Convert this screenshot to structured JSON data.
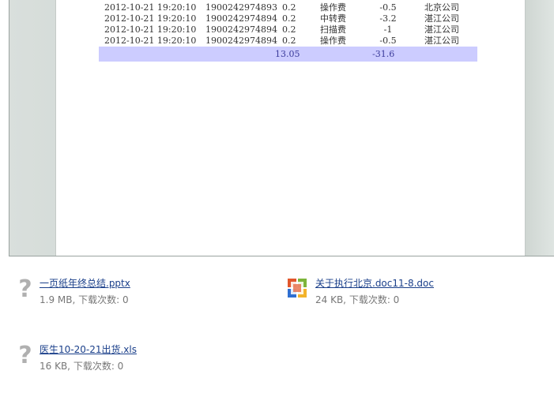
{
  "preview": {
    "rows": [
      {
        "time": "2012-10-21 19:20:10",
        "code": "1900242974893",
        "weight": "0.2",
        "type": "操作费",
        "amount": "-0.5",
        "company": "北京公司"
      },
      {
        "time": "2012-10-21 19:20:10",
        "code": "1900242974894",
        "weight": "0.2",
        "type": "中转费",
        "amount": "-3.2",
        "company": "湛江公司"
      },
      {
        "time": "2012-10-21 19:20:10",
        "code": "1900242974894",
        "weight": "0.2",
        "type": "扫描费",
        "amount": "-1",
        "company": "湛江公司"
      },
      {
        "time": "2012-10-21 19:20:10",
        "code": "1900242974894",
        "weight": "0.2",
        "type": "操作费",
        "amount": "-0.5",
        "company": "湛江公司"
      }
    ],
    "total": {
      "weight_sum": "13.05",
      "amount_sum": "-31.6"
    }
  },
  "attachments": [
    {
      "name": "一页纸年终总结.pptx",
      "meta": "1.9 MB, 下载次数: 0",
      "icon": "unknown-file-icon"
    },
    {
      "name": "关于执行北京.doc11-8.doc",
      "meta": "24 KB, 下载次数: 0",
      "icon": "office-doc-icon"
    },
    {
      "name": "医生10-20-21出货.xls",
      "meta": "16 KB, 下载次数: 0",
      "icon": "unknown-file-icon"
    }
  ]
}
